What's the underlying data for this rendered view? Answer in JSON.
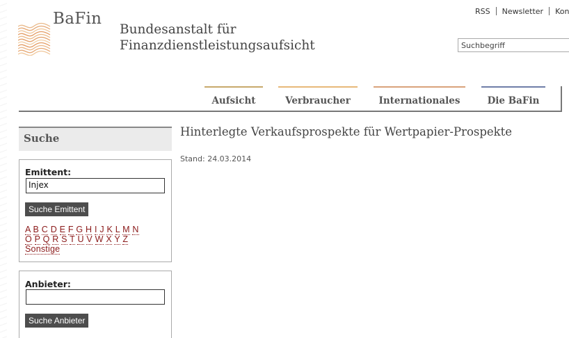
{
  "header": {
    "logo_text": "BaFin",
    "org_name_line1": "Bundesanstalt für",
    "org_name_line2": "Finanzdienstleistungsaufsicht",
    "service_links": [
      "RSS",
      "Newsletter",
      "Kon"
    ],
    "search": {
      "value": "Suchbegriff"
    }
  },
  "nav": {
    "items": [
      {
        "label": "Aufsicht",
        "color": "#c8a96b"
      },
      {
        "label": "Verbraucher",
        "color": "#e7b979"
      },
      {
        "label": "Internationales",
        "color": "#d9a27b"
      },
      {
        "label": "Die BaFin",
        "color": "#6f7ea8"
      }
    ]
  },
  "sidebar": {
    "title": "Suche",
    "emittent": {
      "label": "Emittent:",
      "value": "Injex",
      "button": "Suche Emittent",
      "letters_row1": [
        "A",
        "B",
        "C",
        "D",
        "E",
        "F",
        "G",
        "H",
        "I",
        "J",
        "K",
        "L",
        "M",
        "N"
      ],
      "letters_row2": [
        "O",
        "P",
        "Q",
        "R",
        "S",
        "T",
        "U",
        "V",
        "W",
        "X",
        "Y",
        "Z"
      ],
      "other": "Sonstige"
    },
    "anbieter": {
      "label": "Anbieter:",
      "value": "",
      "button": "Suche Anbieter"
    }
  },
  "main": {
    "title": "Hinterlegte Verkaufsprospekte für Wertpapier-Prospekte",
    "stand": "Stand: 24.03.2014"
  },
  "colors": {
    "link": "#8b1a1a",
    "button_bg": "#4d4d4d",
    "sidebar_title_bg": "#ebebeb"
  }
}
